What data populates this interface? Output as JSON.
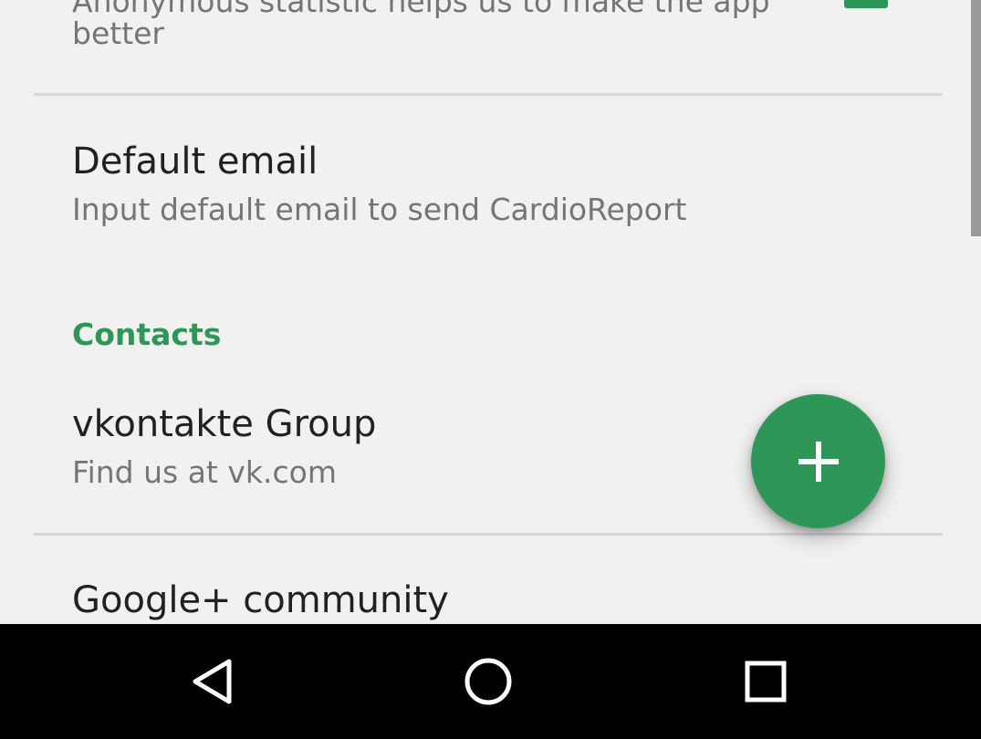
{
  "settings": {
    "statistics_summary_line1": "Anonymous statistic helps us to make the app",
    "statistics_summary_line2": "better",
    "default_email": {
      "title": "Default email",
      "summary": "Input default email to send CardioReport"
    },
    "contacts_category": "Contacts",
    "vkontakte": {
      "title": "vkontakte Group",
      "summary": "Find us at vk.com"
    },
    "google_plus": {
      "title": "Google+ community"
    }
  },
  "colors": {
    "accent": "#2e9656",
    "background": "#f1f1f1",
    "navbar": "#000000"
  },
  "icons": {
    "fab": "plus-icon",
    "nav_back": "back-triangle-icon",
    "nav_home": "home-circle-icon",
    "nav_recents": "recents-square-icon"
  }
}
